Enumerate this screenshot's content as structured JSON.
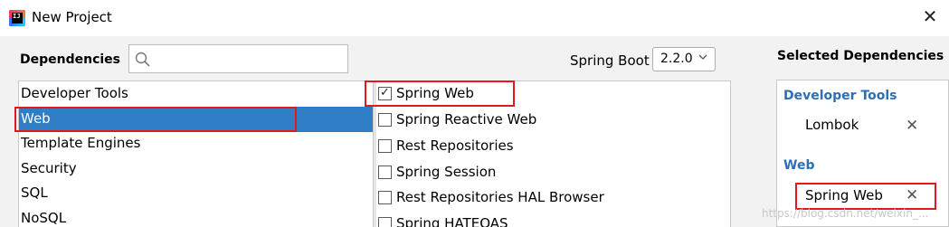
{
  "window": {
    "title": "New Project"
  },
  "dependencies": {
    "label": "Dependencies",
    "search": {
      "value": "",
      "placeholder": ""
    }
  },
  "spring_boot": {
    "label": "Spring Boot",
    "version": "2.2.0"
  },
  "categories": [
    {
      "label": "Developer Tools",
      "selected": false
    },
    {
      "label": "Web",
      "selected": true
    },
    {
      "label": "Template Engines",
      "selected": false
    },
    {
      "label": "Security",
      "selected": false
    },
    {
      "label": "SQL",
      "selected": false
    },
    {
      "label": "NoSQL",
      "selected": false
    }
  ],
  "items": [
    {
      "label": "Spring Web",
      "checked": true,
      "mark": "✓"
    },
    {
      "label": "Spring Reactive Web",
      "checked": false,
      "mark": ""
    },
    {
      "label": "Rest Repositories",
      "checked": false,
      "mark": ""
    },
    {
      "label": "Spring Session",
      "checked": false,
      "mark": ""
    },
    {
      "label": "Rest Repositories HAL Browser",
      "checked": false,
      "mark": ""
    },
    {
      "label": "Spring HATEOAS",
      "checked": false,
      "mark": ""
    }
  ],
  "selected": {
    "label": "Selected Dependencies",
    "groups": [
      {
        "title": "Developer Tools",
        "items": [
          {
            "label": "Lombok",
            "remove": "✕"
          }
        ]
      },
      {
        "title": "Web",
        "items": [
          {
            "label": "Spring Web",
            "remove": "✕"
          }
        ]
      }
    ]
  },
  "watermark": "https://blog.csdn.net/weixin_...",
  "colors": {
    "selection": "#2f7dc5",
    "group_title": "#2c6fb5",
    "highlight_box": "#e0191c"
  }
}
